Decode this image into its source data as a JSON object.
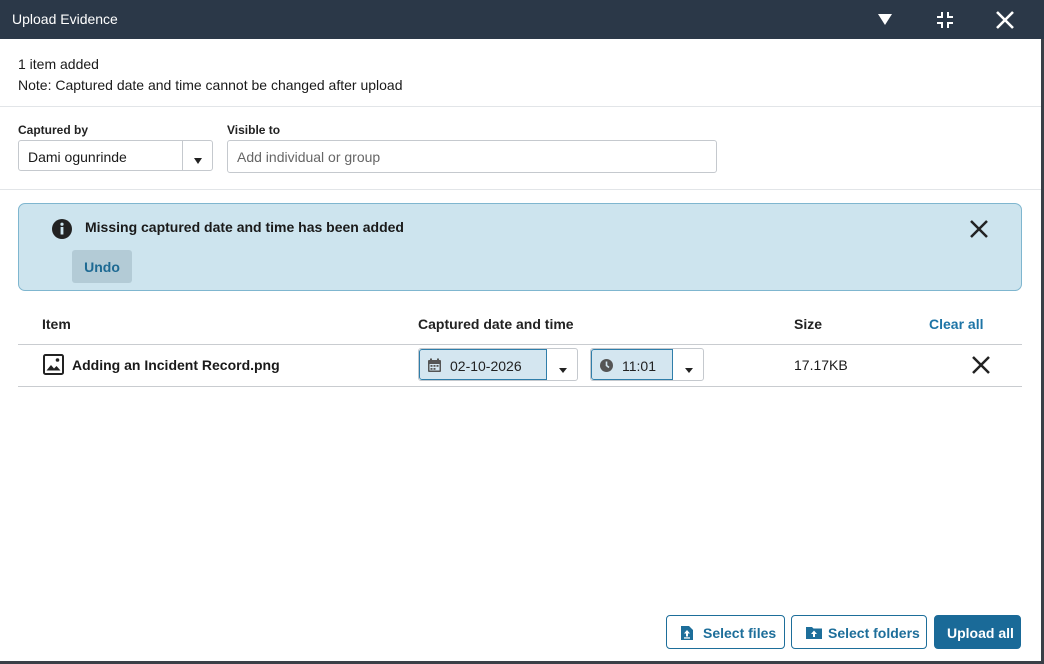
{
  "dialog": {
    "title": "Upload Evidence"
  },
  "info": {
    "count_text": "1 item added",
    "note_text": "Note: Captured date and time cannot be changed after upload"
  },
  "captured_by": {
    "label": "Captured by",
    "value": "Dami ogunrinde"
  },
  "visible_to": {
    "label": "Visible to",
    "placeholder": "Add individual or group"
  },
  "banner": {
    "message": "Missing captured date and time has been added",
    "undo_label": "Undo"
  },
  "table": {
    "headers": {
      "item": "Item",
      "captured": "Captured date and time",
      "size": "Size"
    },
    "clear_all_label": "Clear all",
    "rows": [
      {
        "name": "Adding an Incident Record.png",
        "date": "02-10-2026",
        "time": "11:01",
        "size": "17.17KB"
      }
    ]
  },
  "footer": {
    "select_files_label": "Select files",
    "select_folders_label": "Select folders",
    "upload_all_label": "Upload all"
  },
  "colors": {
    "titlebar": "#2b3848",
    "accent": "#1d74a6",
    "banner_bg": "#cde4ee",
    "banner_border": "#7fb6cf"
  },
  "icons": [
    "chevron-down-icon",
    "minimize-icon",
    "close-icon",
    "info-icon",
    "image-icon",
    "calendar-icon",
    "clock-icon",
    "upload-file-icon",
    "upload-folder-icon"
  ]
}
